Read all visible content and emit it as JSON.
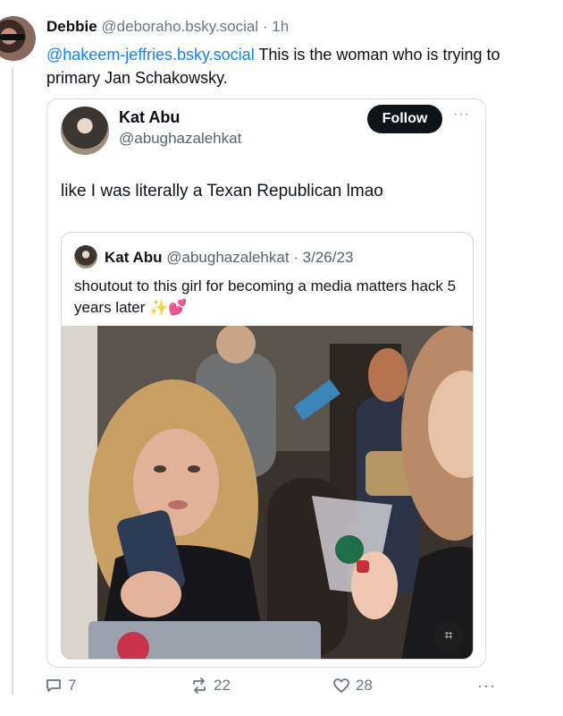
{
  "post": {
    "author_name": "Debbie",
    "author_handle": "@deboraho.bsky.social",
    "separator": " · ",
    "time": "1h",
    "mention": "@hakeem-jeffries.bsky.social",
    "text": " This is the woman who is trying to primary Jan Schakowsky."
  },
  "embed": {
    "name": "Kat Abu",
    "handle": "@abughazalehkat",
    "follow_label": "Follow",
    "more": "···",
    "text": "like I was literally a Texan Republican lmao",
    "quote": {
      "name": "Kat Abu",
      "handle_date": "@abughazalehkat · 3/26/23",
      "text": "shoutout to this girl for becoming a media matters hack 5 years later ",
      "sparkles": "✨",
      "hearts": "💕",
      "ocr_icon": "⌗"
    }
  },
  "actions": {
    "replies": "7",
    "reposts": "22",
    "likes": "28",
    "more": "···"
  },
  "colors": {
    "accent": "#1083fe",
    "muted": "#66788a",
    "border": "#d4dbe2"
  }
}
